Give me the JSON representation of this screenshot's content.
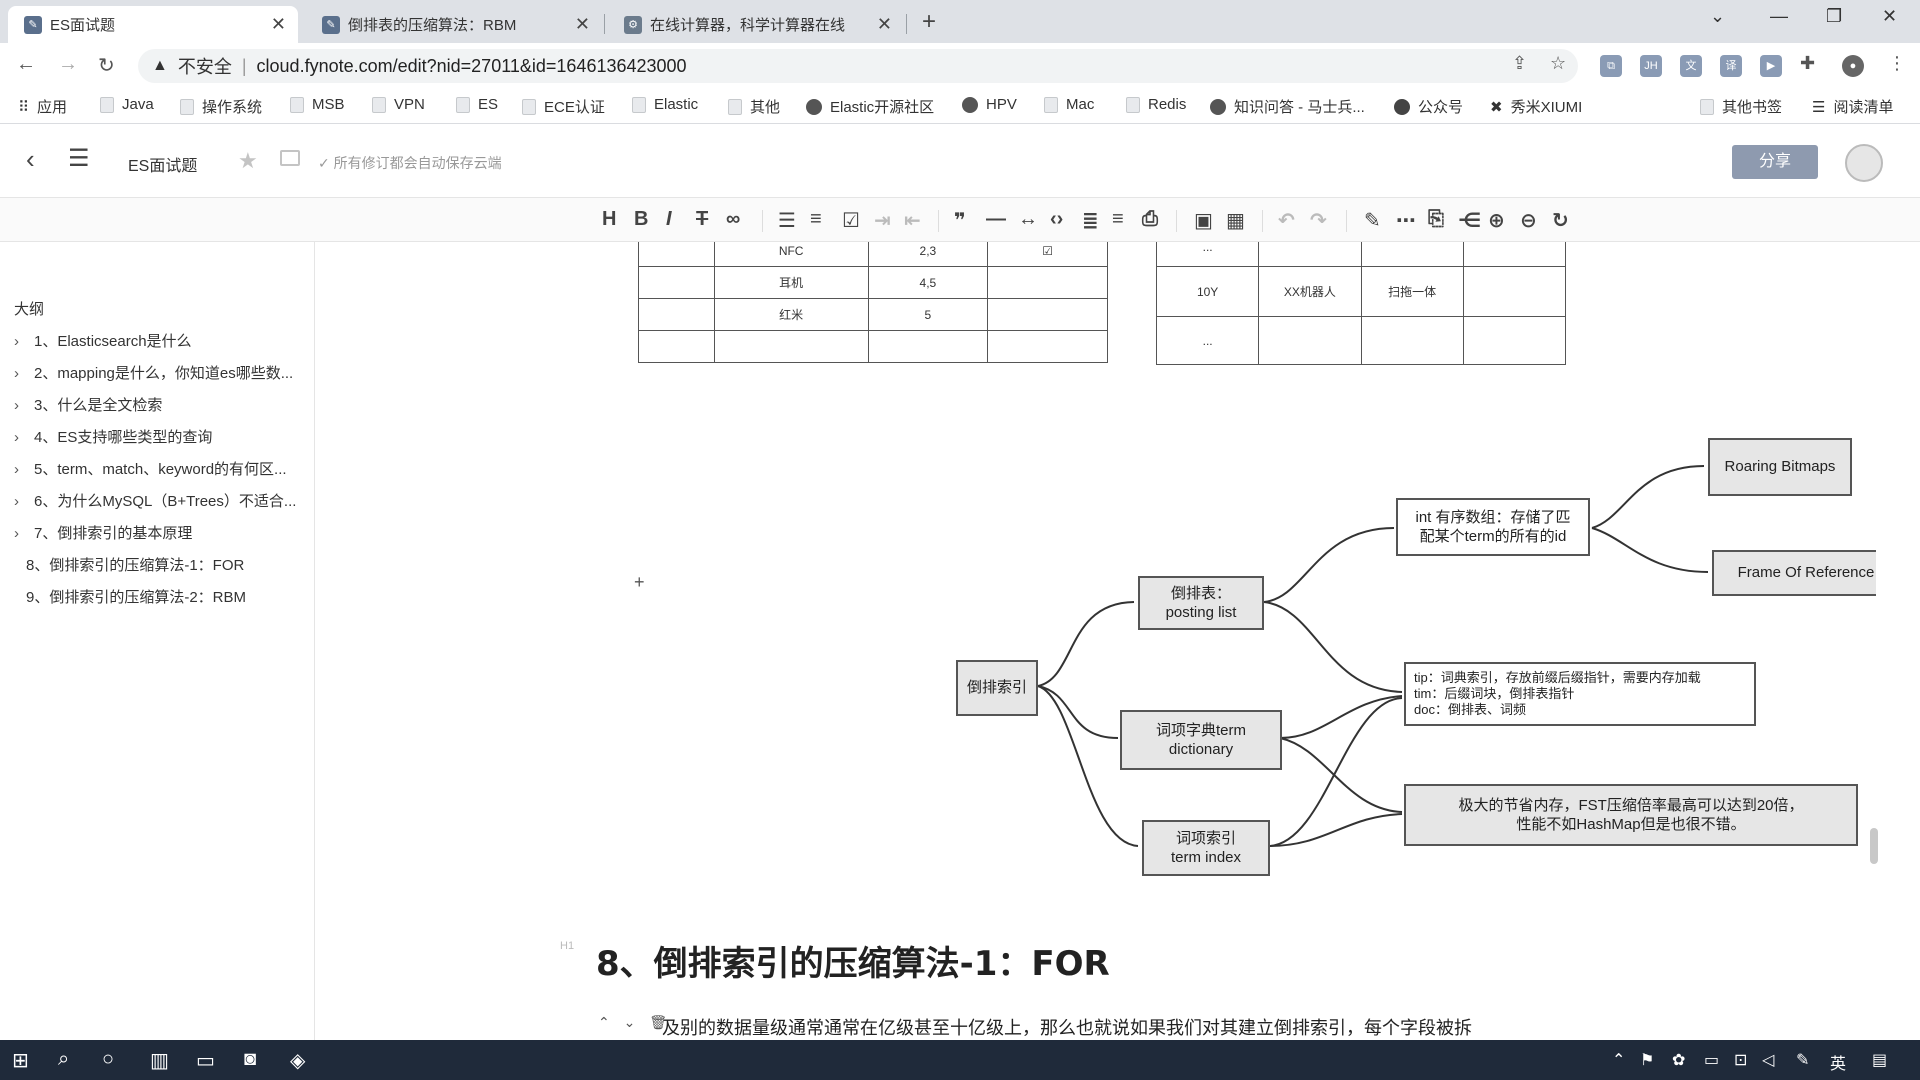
{
  "browser": {
    "tabs": [
      {
        "label": "ES面试题",
        "active": true
      },
      {
        "label": "倒排表的压缩算法：RBM",
        "active": false
      },
      {
        "label": "在线计算器，科学计算器在线",
        "active": false
      }
    ],
    "address": {
      "insecure_label": "不安全",
      "url": "cloud.fynote.com/edit?nid=27011&id=1646136423000"
    },
    "bookmarks": [
      "应用",
      "Java",
      "操作系统",
      "MSB",
      "VPN",
      "ES",
      "ECE认证",
      "Elastic",
      "其他",
      "Elastic开源社区",
      "HPV",
      "Mac",
      "Redis",
      "知识问答 - 马士兵...",
      "公众号",
      "秀米XIUMI",
      "其他书签",
      "阅读清单"
    ]
  },
  "app": {
    "doc_title": "ES面试题",
    "save_status": "所有修订都会自动保存云端",
    "share_label": "分享"
  },
  "sidebar": {
    "title": "大纲",
    "items": [
      {
        "label": "1、Elasticsearch是什么",
        "expandable": true
      },
      {
        "label": "2、mapping是什么，你知道es哪些数...",
        "expandable": true
      },
      {
        "label": "3、什么是全文检索",
        "expandable": true
      },
      {
        "label": "4、ES支持哪些类型的查询",
        "expandable": true
      },
      {
        "label": "5、term、match、keyword的有何区...",
        "expandable": true
      },
      {
        "label": "6、为什么MySQL（B+Trees）不适合...",
        "expandable": true
      },
      {
        "label": "7、倒排索引的基本原理",
        "expandable": true
      },
      {
        "label": "8、倒排索引的压缩算法-1：FOR",
        "expandable": false
      },
      {
        "label": "9、倒排索引的压缩算法-2：RBM",
        "expandable": false
      }
    ]
  },
  "content": {
    "table_left": {
      "rows": [
        [
          "",
          "NFC",
          "2,3",
          "☑"
        ],
        [
          "",
          "耳机",
          "4,5",
          ""
        ],
        [
          "",
          "红米",
          "5",
          ""
        ],
        [
          "",
          "",
          "",
          ""
        ]
      ]
    },
    "table_right": {
      "rows": [
        [
          "...",
          "",
          "",
          ""
        ],
        [
          "10Y",
          "XX机器人",
          "扫拖一体",
          ""
        ],
        [
          "...",
          "",
          "",
          ""
        ]
      ]
    },
    "mindmap": {
      "root": "倒排索引",
      "posting_list": "倒排表：\nposting list",
      "term_dictionary": "词项字典term\ndictionary",
      "term_index": "词项索引\nterm index",
      "int_array": "int 有序数组：存储了匹\n配某个term的所有的id",
      "roaring": "Roaring Bitmaps",
      "for": "Frame Of Reference",
      "files": "tip：词典索引，存放前缀后缀指针，需要内存加载\ntim：后缀词块，倒排表指针\ndoc：倒排表、词频",
      "fst": "极大的节省内存，FST压缩倍率最高可以达到20倍，\n性能不如HashMap但是也很不错。"
    },
    "h1_tag": "H1",
    "heading": "8、倒排索引的压缩算法-1：FOR",
    "paragraph": "及别的数据量级通常通常在亿级甚至十亿级上，那么也就说如果我们对其建立倒排索引，每个字段被拆"
  },
  "taskbar": {
    "ime_label": "英"
  }
}
